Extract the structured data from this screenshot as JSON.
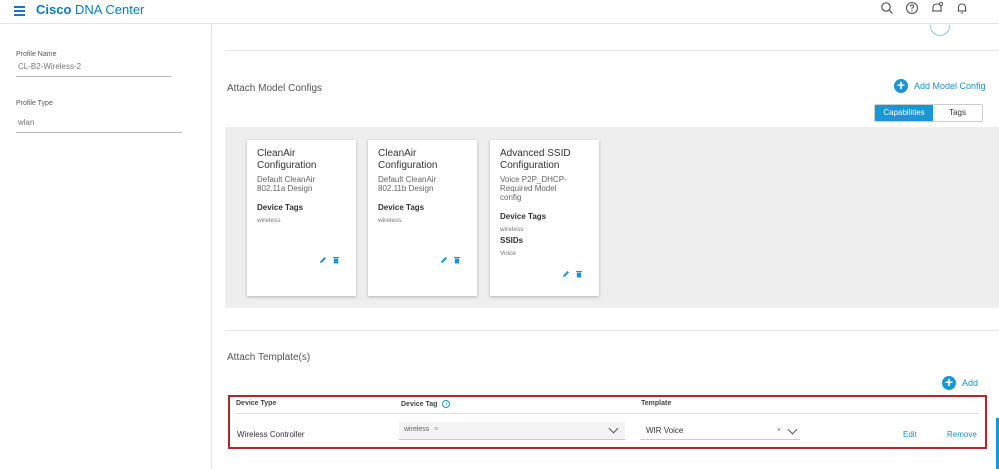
{
  "app": {
    "brand_bold": "Cisco",
    "brand_rest": " DNA Center"
  },
  "header_icons": [
    "search-icon",
    "help-icon",
    "notifications-icon",
    "alerts-bell-icon"
  ],
  "sidebar": {
    "profile_name_label": "Profile Name",
    "profile_name_value": "CL-B2-Wireless-2",
    "profile_type_label": "Profile Type",
    "profile_type_value": "wlan"
  },
  "model_configs": {
    "title": "Attach Model Configs",
    "add_label": "Add Model Config",
    "tabs": [
      {
        "label": "Capabilities",
        "active": true
      },
      {
        "label": "Tags",
        "active": false
      }
    ],
    "cards": [
      {
        "title_line1": "CleanAir",
        "title_line2": "Configuration",
        "desc_line1": "Default CleanAir",
        "desc_line2": "802.11a Design",
        "desc_line3": "",
        "tags_label": "Device Tags",
        "tags_value": "wireless",
        "ssids_label": "",
        "ssids_value": ""
      },
      {
        "title_line1": "CleanAir",
        "title_line2": "Configuration",
        "desc_line1": "Default CleanAir",
        "desc_line2": "802.11b Design",
        "desc_line3": "",
        "tags_label": "Device Tags",
        "tags_value": "wireless",
        "ssids_label": "",
        "ssids_value": ""
      },
      {
        "title_line1": "Advanced SSID",
        "title_line2": "Configuration",
        "desc_line1": "Voice P2P_DHCP-",
        "desc_line2": "Required Model",
        "desc_line3": "config",
        "tags_label": "Device Tags",
        "tags_value": "wireless",
        "ssids_label": "SSIDs",
        "ssids_value": "Voice"
      }
    ]
  },
  "templates": {
    "title": "Attach Template(s)",
    "add_label": "Add",
    "columns": {
      "device_type": "Device Type",
      "device_tag": "Device Tag",
      "template": "Template"
    },
    "row": {
      "device_type": "Wireless Controller",
      "device_tag_chip": "wireless",
      "chip_remove": "×",
      "template_value": "WIR Voice",
      "template_clear": "×",
      "edit": "Edit",
      "remove": "Remove"
    }
  },
  "colors": {
    "accent": "#1a96d4",
    "highlight_border": "#b2262a",
    "brand": "#0a7bbf"
  }
}
